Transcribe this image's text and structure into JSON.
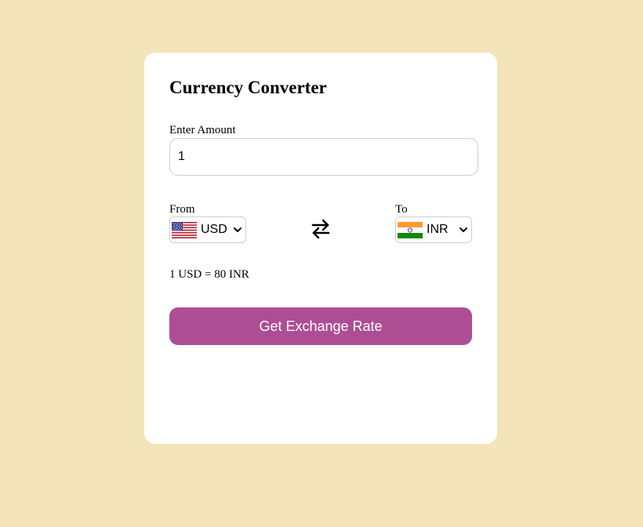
{
  "colors": {
    "page_background": "#f3e4ba",
    "card_background": "#ffffff",
    "button_background": "#ad4e94",
    "button_text": "#ffffff"
  },
  "converter": {
    "title": "Currency Converter",
    "amount_label": "Enter Amount",
    "amount_value": "1",
    "from_label": "From",
    "from_currency": "USD",
    "from_flag_icon": "us-flag-icon",
    "to_label": "To",
    "to_currency": "INR",
    "to_flag_icon": "india-flag-icon",
    "swap_icon": "swap-arrows-icon",
    "rate_text": "1 USD = 80 INR",
    "button_label": "Get Exchange Rate"
  }
}
